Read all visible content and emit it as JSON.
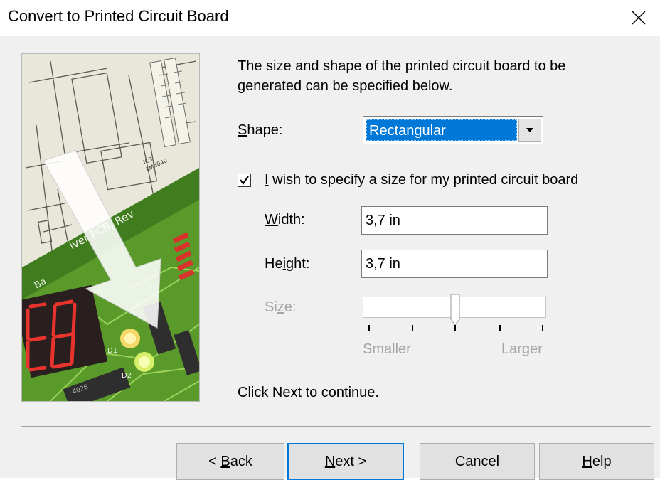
{
  "window": {
    "title": "Convert to Printed Circuit Board",
    "close_icon": "close-x-icon"
  },
  "wizard_image": {
    "icon": "pcb-wizard-illustration",
    "labels": {
      "board_text": "iver PCB, Rev",
      "chip_1": "IC3",
      "chip_2": "LM4040",
      "led_1": "D1",
      "led_2": "D2",
      "chip_3": "4026",
      "label_ba": "Ba"
    }
  },
  "intro": {
    "line1": "The size and shape of the printed circuit board to be",
    "line2": "generated can be specified below."
  },
  "shape": {
    "label_pre": "",
    "label_key": "S",
    "label_post": "hape:",
    "selected": "Rectangular",
    "dropdown_icon": "chevron-down-icon"
  },
  "specify_size": {
    "checked": true,
    "label_key": "I",
    "label_post": " wish to specify a size for my printed circuit board"
  },
  "width": {
    "label_key": "W",
    "label_post": "idth:",
    "value": "3,7 in"
  },
  "height": {
    "label_pre": "He",
    "label_key": "i",
    "label_post": "ght:",
    "value": "3,7 in"
  },
  "size": {
    "label_pre": "Si",
    "label_key": "z",
    "label_post": "e:",
    "enabled": false,
    "level_fraction": 0.5,
    "min_label": "Smaller",
    "max_label": "Larger"
  },
  "footer_text": "Click Next to continue.",
  "buttons": {
    "back": {
      "pre": "< ",
      "key": "B",
      "post": "ack"
    },
    "next": {
      "pre": "",
      "key": "N",
      "post": "ext >"
    },
    "cancel": {
      "label": "Cancel"
    },
    "help": {
      "pre": "",
      "key": "H",
      "post": "elp"
    }
  },
  "colors": {
    "accent": "#0078d7",
    "dialog_bg": "#f0f0f0",
    "disabled_text": "#a4a4a4"
  }
}
